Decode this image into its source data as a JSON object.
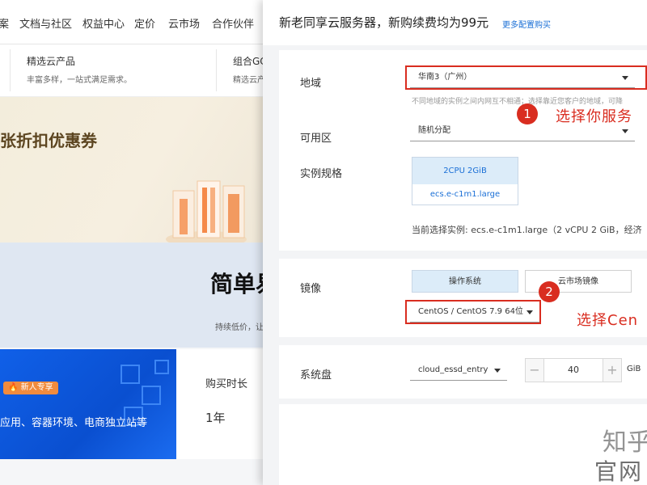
{
  "background_page": {
    "top_nav": [
      "案",
      "文档与社区",
      "权益中心",
      "定价",
      "云市场",
      "合作伙伴"
    ],
    "sub_nav": [
      {
        "title": "精选云产品",
        "desc": "丰富多样，一站式满足需求。"
      },
      {
        "title": "组合GC",
        "desc": "精选云产"
      }
    ],
    "banner_title": "张折扣优惠券",
    "promo_title": "简单易",
    "promo_subtitle": "持续低价，让",
    "new_user_badge": "新人专享",
    "blue_card_text": "应用、容器环境、电商独立站等",
    "buy_duration_label": "购买时长",
    "buy_duration_value": "1年"
  },
  "config_panel": {
    "title": "新老同享云服务器，新购续费均为99元",
    "more_link": "更多配置购买",
    "region": {
      "label": "地域",
      "value": "华南3（广州）",
      "hint": "不同地域的实例之间内网互不相通；选择靠近您客户的地域，可降"
    },
    "zone": {
      "label": "可用区",
      "value": "随机分配"
    },
    "instance_spec": {
      "label": "实例规格",
      "cpu_mem": "2CPU 2GiB",
      "type": "ecs.e-c1m1.large",
      "current": "当前选择实例: ecs.e-c1m1.large（2 vCPU 2 GiB，经济"
    },
    "image": {
      "label": "镜像",
      "tab_os": "操作系统",
      "tab_market": "云市场镜像",
      "value": "CentOS / CentOS 7.9 64位"
    },
    "system_disk": {
      "label": "系统盘",
      "type": "cloud_essd_entry",
      "minus": "−",
      "size": "40",
      "plus": "+",
      "unit": "GiB"
    }
  },
  "annotations": {
    "step1_num": "1",
    "step1_text": "选择你服务",
    "step2_num": "2",
    "step2_text": "选择Cen"
  },
  "watermark": {
    "top": "知乎 ·费币",
    "bottom": "官网"
  },
  "colors": {
    "annotation_red": "#d92d20",
    "link_blue": "#1a6fd6",
    "spec_bg": "#dcecf9",
    "promo_blue": "#0a4fd0"
  }
}
